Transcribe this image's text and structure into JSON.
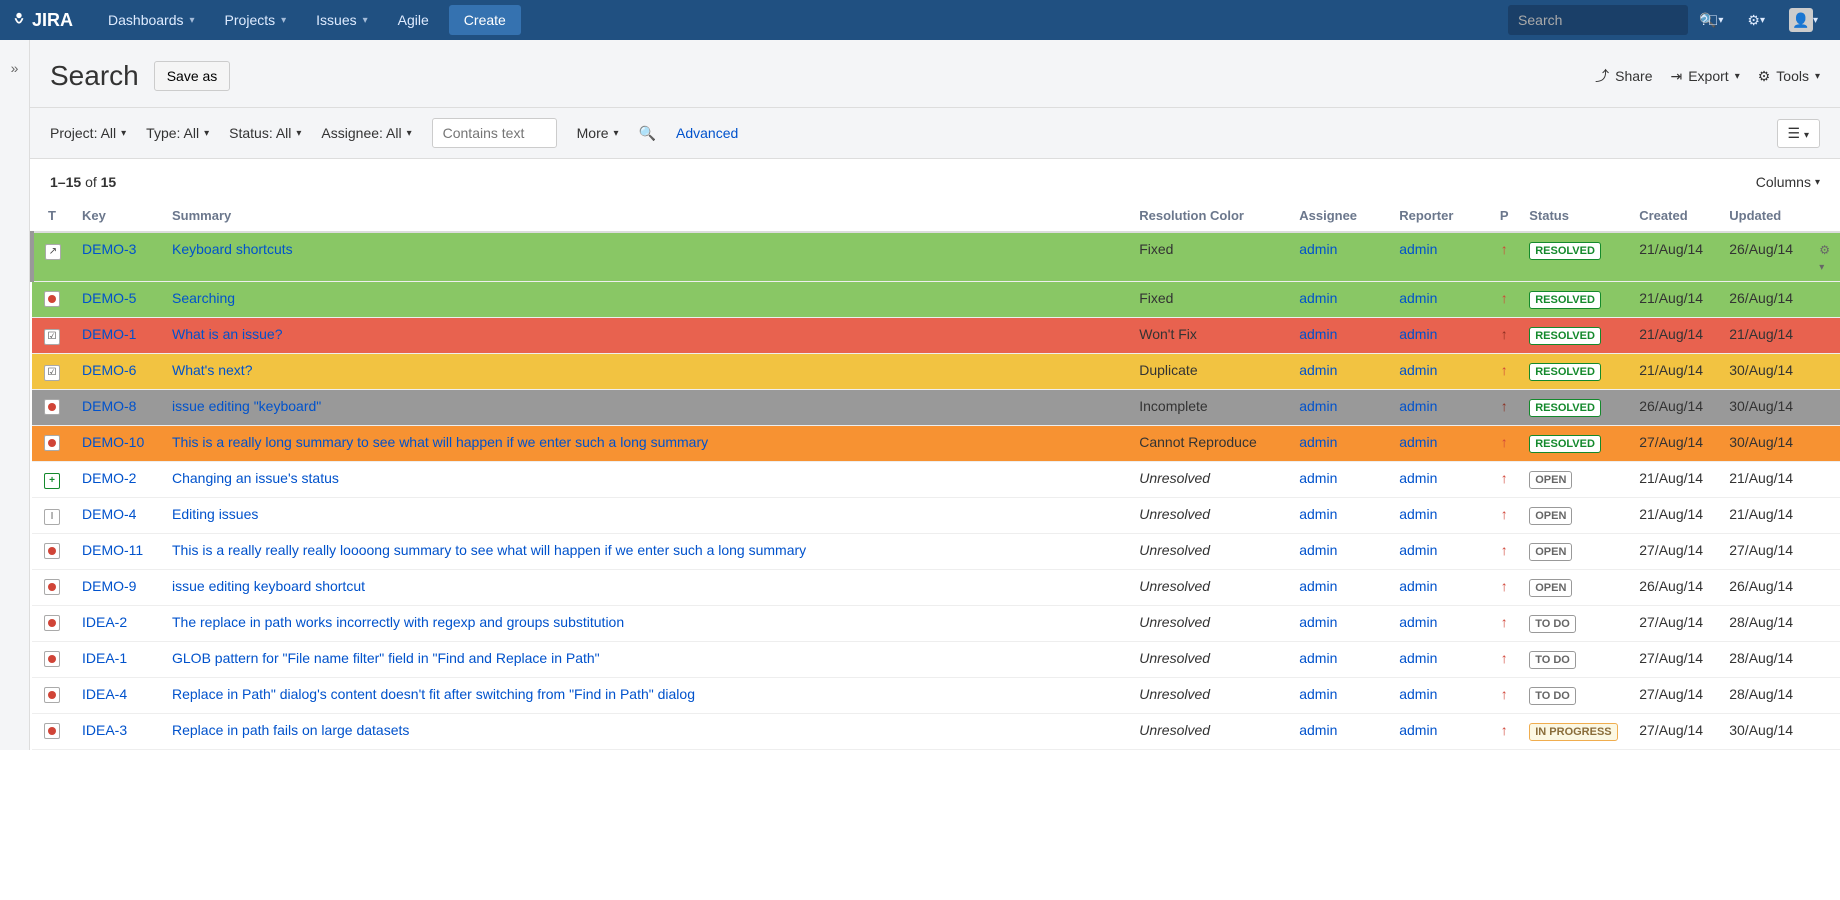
{
  "nav": {
    "logo": "JIRA",
    "dashboards": "Dashboards",
    "projects": "Projects",
    "issues": "Issues",
    "agile": "Agile",
    "create": "Create",
    "search_placeholder": "Search"
  },
  "page": {
    "title": "Search",
    "save_as": "Save as",
    "share": "Share",
    "export": "Export",
    "tools": "Tools"
  },
  "filters": {
    "project": "Project: All",
    "type": "Type: All",
    "status": "Status: All",
    "assignee": "Assignee: All",
    "contains_placeholder": "Contains text",
    "more": "More",
    "advanced": "Advanced"
  },
  "results": {
    "range_from": "1",
    "range_to": "15",
    "of_label": "of",
    "total": "15",
    "columns": "Columns"
  },
  "headers": {
    "type": "T",
    "key": "Key",
    "summary": "Summary",
    "resolution": "Resolution Color",
    "assignee": "Assignee",
    "reporter": "Reporter",
    "priority": "P",
    "status": "Status",
    "created": "Created",
    "updated": "Updated"
  },
  "issues": [
    {
      "key": "DEMO-3",
      "summary": "Keyboard shortcuts",
      "resolution": "Fixed",
      "assignee": "admin",
      "reporter": "admin",
      "status": "RESOLVED",
      "statusClass": "status-resolved",
      "created": "21/Aug/14",
      "updated": "26/Aug/14",
      "rowClass": "row-green row-selected",
      "typeClass": "type-arrow",
      "typeChar": "↗",
      "unresolved": false,
      "selected": true
    },
    {
      "key": "DEMO-5",
      "summary": "Searching",
      "resolution": "Fixed",
      "assignee": "admin",
      "reporter": "admin",
      "status": "RESOLVED",
      "statusClass": "status-resolved",
      "created": "21/Aug/14",
      "updated": "26/Aug/14",
      "rowClass": "row-green",
      "typeClass": "type-bug",
      "typeChar": "",
      "unresolved": false
    },
    {
      "key": "DEMO-1",
      "summary": "What is an issue?",
      "resolution": "Won't Fix",
      "assignee": "admin",
      "reporter": "admin",
      "status": "RESOLVED",
      "statusClass": "status-resolved",
      "created": "21/Aug/14",
      "updated": "21/Aug/14",
      "rowClass": "row-red",
      "typeClass": "type-task",
      "typeChar": "☑",
      "unresolved": false
    },
    {
      "key": "DEMO-6",
      "summary": "What's next?",
      "resolution": "Duplicate",
      "assignee": "admin",
      "reporter": "admin",
      "status": "RESOLVED",
      "statusClass": "status-resolved",
      "created": "21/Aug/14",
      "updated": "30/Aug/14",
      "rowClass": "row-yellow",
      "typeClass": "type-task",
      "typeChar": "☑",
      "unresolved": false
    },
    {
      "key": "DEMO-8",
      "summary": "issue editing \"keyboard\"",
      "resolution": "Incomplete",
      "assignee": "admin",
      "reporter": "admin",
      "status": "RESOLVED",
      "statusClass": "status-resolved",
      "created": "26/Aug/14",
      "updated": "30/Aug/14",
      "rowClass": "row-grey",
      "typeClass": "type-bug",
      "typeChar": "",
      "unresolved": false
    },
    {
      "key": "DEMO-10",
      "summary": "This is a really long summary to see what will happen if we enter such a long summary",
      "resolution": "Cannot Reproduce",
      "assignee": "admin",
      "reporter": "admin",
      "status": "RESOLVED",
      "statusClass": "status-resolved",
      "created": "27/Aug/14",
      "updated": "30/Aug/14",
      "rowClass": "row-orange",
      "typeClass": "type-bug",
      "typeChar": "",
      "unresolved": false
    },
    {
      "key": "DEMO-2",
      "summary": "Changing an issue's status",
      "resolution": "Unresolved",
      "assignee": "admin",
      "reporter": "admin",
      "status": "OPEN",
      "statusClass": "status-open",
      "created": "21/Aug/14",
      "updated": "21/Aug/14",
      "rowClass": "",
      "typeClass": "type-plus",
      "typeChar": "+",
      "unresolved": true
    },
    {
      "key": "DEMO-4",
      "summary": "Editing issues",
      "resolution": "Unresolved",
      "assignee": "admin",
      "reporter": "admin",
      "status": "OPEN",
      "statusClass": "status-open",
      "created": "21/Aug/14",
      "updated": "21/Aug/14",
      "rowClass": "",
      "typeClass": "type-edit",
      "typeChar": "I",
      "unresolved": true
    },
    {
      "key": "DEMO-11",
      "summary": "This is a really really really loooong summary to see what will happen if we enter such a long summary",
      "resolution": "Unresolved",
      "assignee": "admin",
      "reporter": "admin",
      "status": "OPEN",
      "statusClass": "status-open",
      "created": "27/Aug/14",
      "updated": "27/Aug/14",
      "rowClass": "",
      "typeClass": "type-bug",
      "typeChar": "",
      "unresolved": true
    },
    {
      "key": "DEMO-9",
      "summary": "issue editing keyboard shortcut",
      "resolution": "Unresolved",
      "assignee": "admin",
      "reporter": "admin",
      "status": "OPEN",
      "statusClass": "status-open",
      "created": "26/Aug/14",
      "updated": "26/Aug/14",
      "rowClass": "",
      "typeClass": "type-bug",
      "typeChar": "",
      "unresolved": true
    },
    {
      "key": "IDEA-2",
      "summary": "The replace in path works incorrectly with regexp and groups substitution",
      "resolution": "Unresolved",
      "assignee": "admin",
      "reporter": "admin",
      "status": "TO DO",
      "statusClass": "status-todo",
      "created": "27/Aug/14",
      "updated": "28/Aug/14",
      "rowClass": "",
      "typeClass": "type-bug",
      "typeChar": "",
      "unresolved": true
    },
    {
      "key": "IDEA-1",
      "summary": "GLOB pattern for \"File name filter\" field in \"Find and Replace in Path\"",
      "resolution": "Unresolved",
      "assignee": "admin",
      "reporter": "admin",
      "status": "TO DO",
      "statusClass": "status-todo",
      "created": "27/Aug/14",
      "updated": "28/Aug/14",
      "rowClass": "",
      "typeClass": "type-bug",
      "typeChar": "",
      "unresolved": true
    },
    {
      "key": "IDEA-4",
      "summary": "Replace in Path\" dialog's content doesn't fit after switching from \"Find in Path\" dialog",
      "resolution": "Unresolved",
      "assignee": "admin",
      "reporter": "admin",
      "status": "TO DO",
      "statusClass": "status-todo",
      "created": "27/Aug/14",
      "updated": "28/Aug/14",
      "rowClass": "",
      "typeClass": "type-bug",
      "typeChar": "",
      "unresolved": true
    },
    {
      "key": "IDEA-3",
      "summary": "Replace in path fails on large datasets",
      "resolution": "Unresolved",
      "assignee": "admin",
      "reporter": "admin",
      "status": "IN PROGRESS",
      "statusClass": "status-inprogress",
      "created": "27/Aug/14",
      "updated": "30/Aug/14",
      "rowClass": "",
      "typeClass": "type-bug",
      "typeChar": "",
      "unresolved": true
    }
  ]
}
